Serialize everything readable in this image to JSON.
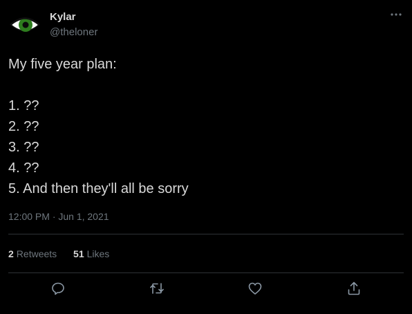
{
  "user": {
    "display_name": "Kylar",
    "handle": "@theloner",
    "avatar_icon": "green-eye-icon"
  },
  "tweet": {
    "lines": [
      "My five year plan:",
      "",
      "1. ??",
      "2. ??",
      "3. ??",
      "4. ??",
      "5. And then they'll all be sorry"
    ],
    "timestamp": "12:00 PM · Jun 1, 2021"
  },
  "stats": {
    "retweets_count": "2",
    "retweets_label": "Retweets",
    "likes_count": "51",
    "likes_label": "Likes"
  },
  "actions": [
    "reply-icon",
    "retweet-icon",
    "like-icon",
    "share-icon"
  ],
  "colors": {
    "background": "#000000",
    "text": "#d9d9d9",
    "secondary": "#6e767d",
    "divider": "#2f3336",
    "eye_green": "#2e7d1e"
  }
}
